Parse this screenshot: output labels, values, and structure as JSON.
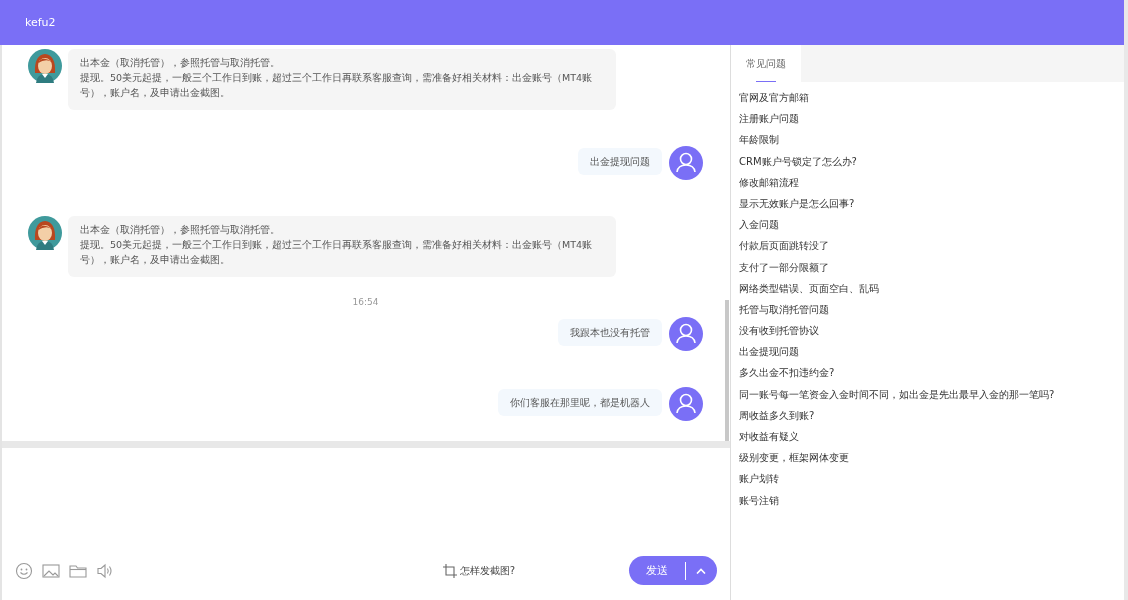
{
  "header": {
    "title": "kefu2"
  },
  "messages": [
    {
      "kind": "agent",
      "lines": [
        "出本金（取消托管），参照托管与取消托管。",
        "提现。50美元起提，一般三个工作日到账，超过三个工作日再联系客服查询，需准备好相关材料：出金账号（MT4账号），账户名，及申请出金截图。"
      ]
    },
    {
      "kind": "user",
      "lines": [
        "出金提现问题"
      ]
    },
    {
      "kind": "agent",
      "lines": [
        "出本金（取消托管），参照托管与取消托管。",
        "提现。50美元起提，一般三个工作日到账，超过三个工作日再联系客服查询，需准备好相关材料：出金账号（MT4账号），账户名，及申请出金截图。"
      ]
    },
    {
      "kind": "time",
      "lines": [
        "16:54"
      ]
    },
    {
      "kind": "user",
      "lines": [
        "我跟本也没有托管"
      ]
    },
    {
      "kind": "user",
      "lines": [
        "你们客服在那里呢，都是机器人"
      ]
    }
  ],
  "composer": {
    "screenshot_hint": "怎样发截图?",
    "send_label": "发送"
  },
  "faq": {
    "tabs": [
      {
        "label": "常见问题",
        "selected": true
      }
    ],
    "items": [
      "官网及官方邮箱",
      "注册账户问题",
      "年龄限制",
      "CRM账户号锁定了怎么办?",
      "修改邮箱流程",
      "显示无效账户是怎么回事?",
      "入金问题",
      "付款后页面跳转没了",
      "支付了一部分限额了",
      "网络类型错误、页面空白、乱码",
      "托管与取消托管问题",
      "没有收到托管协议",
      "出金提现问题",
      "多久出金不扣违约金?",
      "同一账号每一笔资金入金时间不同，如出金是先出最早入金的那一笔吗?",
      "周收益多久到账?",
      "对收益有疑义",
      "级别变更，框架网体变更",
      "账户划转",
      "账号注销"
    ]
  }
}
